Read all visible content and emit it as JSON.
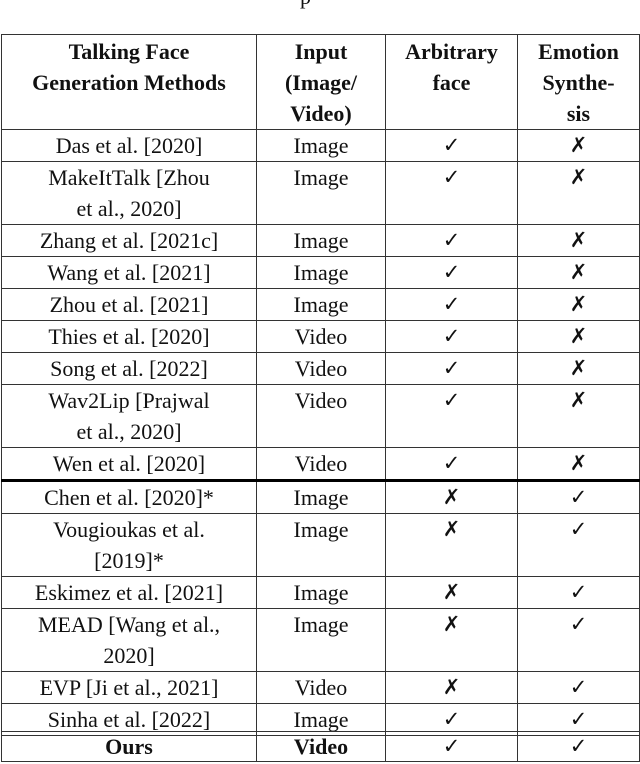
{
  "caption_fragment": "p",
  "headers": [
    "Talking Face Generation Methods",
    "Input (Image/ Video)",
    "Arbitrary face",
    "Emotion Synthe- sis"
  ],
  "header_lines": [
    [
      "Talking Face",
      "Generation Methods"
    ],
    [
      "Input",
      "(Image/",
      "Video)"
    ],
    [
      "Arbitrary",
      "face"
    ],
    [
      "Emotion",
      "Synthe-",
      "sis"
    ]
  ],
  "marks": {
    "yes": "✓",
    "no": "✗"
  },
  "rows": [
    {
      "method": "Das et al. [2020]",
      "input": "Image",
      "arbitrary_face": "✓",
      "emotion": "✗"
    },
    {
      "method": "MakeItTalk [Zhou et al., 2020]",
      "input": "Image",
      "arbitrary_face": "✓",
      "emotion": "✗"
    },
    {
      "method": "Zhang et al. [2021c]",
      "input": "Image",
      "arbitrary_face": "✓",
      "emotion": "✗"
    },
    {
      "method": "Wang et al. [2021]",
      "input": "Image",
      "arbitrary_face": "✓",
      "emotion": "✗"
    },
    {
      "method": "Zhou et al. [2021]",
      "input": "Image",
      "arbitrary_face": "✓",
      "emotion": "✗"
    },
    {
      "method": "Thies et al. [2020]",
      "input": "Video",
      "arbitrary_face": "✓",
      "emotion": "✗"
    },
    {
      "method": "Song et al. [2022]",
      "input": "Video",
      "arbitrary_face": "✓",
      "emotion": "✗"
    },
    {
      "method": "Wav2Lip [Prajwal et al., 2020]",
      "input": "Video",
      "arbitrary_face": "✓",
      "emotion": "✗"
    },
    {
      "method": "Wen et al. [2020]",
      "input": "Video",
      "arbitrary_face": "✓",
      "emotion": "✗"
    },
    {
      "method": "Chen et al. [2020]*",
      "input": "Image",
      "arbitrary_face": "✗",
      "emotion": "✓"
    },
    {
      "method": "Vougioukas et al. [2019]*",
      "input": "Image",
      "arbitrary_face": "✗",
      "emotion": "✓"
    },
    {
      "method": "Eskimez et al. [2021]",
      "input": "Image",
      "arbitrary_face": "✗",
      "emotion": "✓"
    },
    {
      "method": "MEAD [Wang et al., 2020]",
      "input": "Image",
      "arbitrary_face": "✗",
      "emotion": "✓"
    },
    {
      "method": "EVP [Ji et al., 2021]",
      "input": "Video",
      "arbitrary_face": "✗",
      "emotion": "✓"
    },
    {
      "method": "Sinha et al. [2022]",
      "input": "Image",
      "arbitrary_face": "✓",
      "emotion": "✓"
    }
  ],
  "method_lines": {
    "1": [
      "MakeItTalk [Zhou",
      "et al., 2020]"
    ],
    "7": [
      "Wav2Lip [Prajwal",
      "et al., 2020]"
    ],
    "10": [
      "Vougioukas et al.",
      "[2019]*"
    ],
    "12": [
      "MEAD [Wang et al.,",
      "2020]"
    ]
  },
  "ours": {
    "method": "Ours",
    "input": "Video",
    "arbitrary_face": "✓",
    "emotion": "✓"
  }
}
